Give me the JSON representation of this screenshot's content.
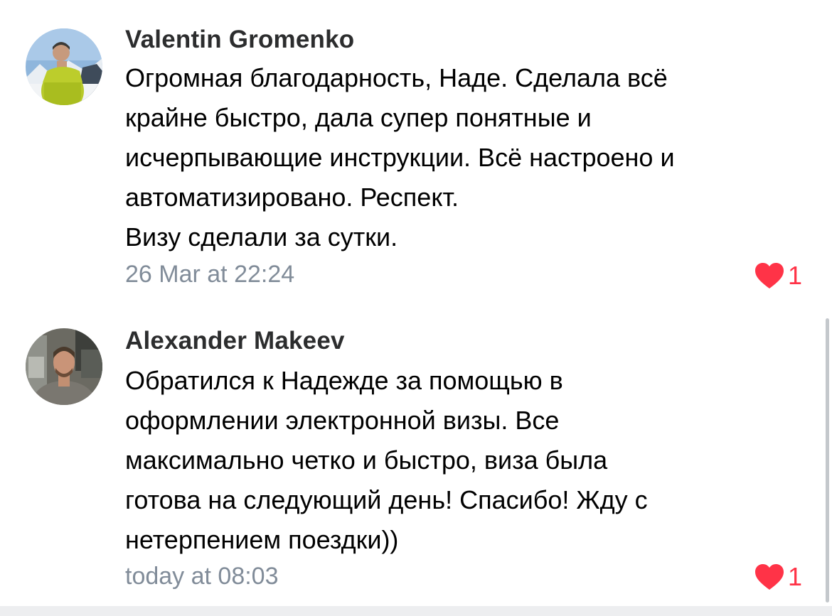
{
  "comments": [
    {
      "author": "Valentin Gromenko",
      "lines": [
        "Огромная благодарность, Наде. Сделала всё",
        "крайне быстро, дала супер понятные и",
        "исчерпывающие инструкции. Всё настроено и",
        "автоматизировано. Респект.",
        "Визу сделали за сутки."
      ],
      "timestamp": "26 Mar at 22:24",
      "likes": "1"
    },
    {
      "author": "Alexander Makeev",
      "lines": [
        "Обратился к Надежде за помощью в",
        "оформлении электронной визы. Все",
        "максимально четко и быстро, виза была",
        "готова на следующий день! Спасибо! Жду с",
        "нетерпением поездки))"
      ],
      "timestamp": "today at 08:03",
      "likes": "1"
    }
  ],
  "colors": {
    "like": "#ff3347",
    "meta": "#818c99",
    "author": "#2c2d2e"
  },
  "icons": [
    "heart-icon"
  ]
}
